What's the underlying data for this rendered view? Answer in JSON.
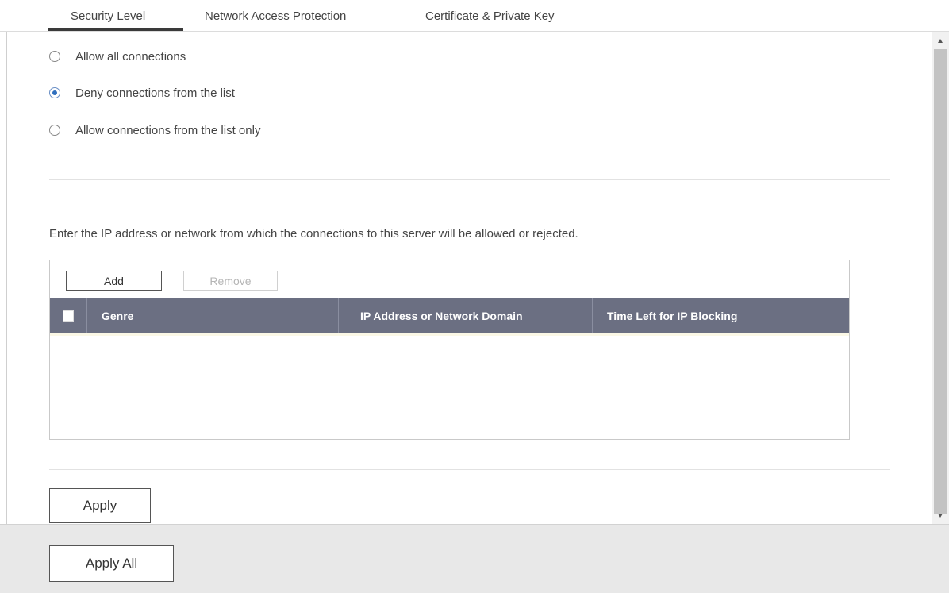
{
  "tabs": [
    {
      "label": "Security Level",
      "active": true
    },
    {
      "label": "Network Access Protection",
      "active": false
    },
    {
      "label": "Certificate & Private Key",
      "active": false
    }
  ],
  "security_level": {
    "options": [
      {
        "label": "Allow all connections",
        "selected": false
      },
      {
        "label": "Deny connections from the list",
        "selected": true
      },
      {
        "label": "Allow connections from the list only",
        "selected": false
      }
    ],
    "description": "Enter the IP address or network from which the connections to this server will be allowed or rejected."
  },
  "table": {
    "add_label": "Add",
    "remove_label": "Remove",
    "columns": [
      "Genre",
      "IP Address or Network Domain",
      "Time Left for IP Blocking"
    ],
    "rows": []
  },
  "apply_label": "Apply",
  "footer": {
    "apply_all_label": "Apply All"
  },
  "colors": {
    "header_bg": "#6b6f82",
    "radio_selected": "#2f6fbe",
    "footer_bg": "#e8e8e8"
  }
}
